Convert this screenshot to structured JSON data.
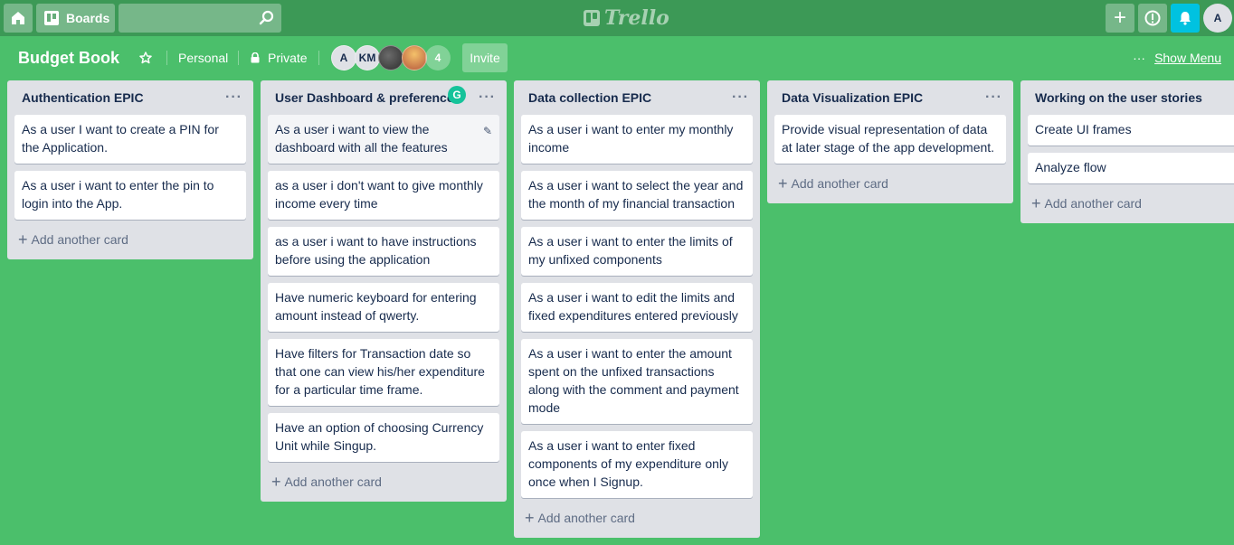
{
  "topbar": {
    "boards_label": "Boards",
    "search_placeholder": "",
    "logo_text": "Trello",
    "avatar_initial": "A"
  },
  "board": {
    "title": "Budget Book",
    "team": "Personal",
    "visibility": "Private",
    "members": [
      "A",
      "KM"
    ],
    "member_count": "4",
    "invite_label": "Invite",
    "show_menu_label": "Show Menu",
    "menu_dots": "···"
  },
  "add_card_label": "Add another card",
  "list_menu_dots": "···",
  "lists": [
    {
      "title": "Authentication EPIC",
      "cards": [
        "As a user I want to create a PIN for the Application.",
        "As a user i want to enter the pin to login into the App."
      ]
    },
    {
      "title": "User Dashboard & preferences",
      "cards": [
        "As a user i want to view the dashboard with all the features",
        "as a user i don't want to give monthly income every time",
        "as a user i want to have instructions before using the application",
        "Have numeric keyboard for entering amount instead of qwerty.",
        "Have filters for Transaction date so that one can view his/her expenditure for a particular time frame.",
        "Have an option of choosing Currency Unit while Singup."
      ]
    },
    {
      "title": "Data collection EPIC",
      "cards": [
        "As a user i want to enter my monthly income",
        "As a user i want to select the year and the month of my financial transaction",
        "As a user i want to enter the limits of my unfixed components",
        "As a user i want to edit the limits and fixed expenditures entered previously",
        "As a user i want to enter the amount spent on the unfixed transactions along with the comment and payment mode",
        "As a user i want to enter fixed components of my expenditure only once when I Signup."
      ]
    },
    {
      "title": "Data Visualization EPIC",
      "cards": [
        "Provide visual representation of data at later stage of the app development."
      ]
    },
    {
      "title": "Working on the user stories",
      "cards": [
        "Create UI frames",
        "Analyze flow"
      ]
    }
  ],
  "colors": {
    "board_bg": "#4bbf6b",
    "header_bg": "#3c9956",
    "list_bg": "#dfe1e6",
    "notification": "#00c2e0"
  }
}
